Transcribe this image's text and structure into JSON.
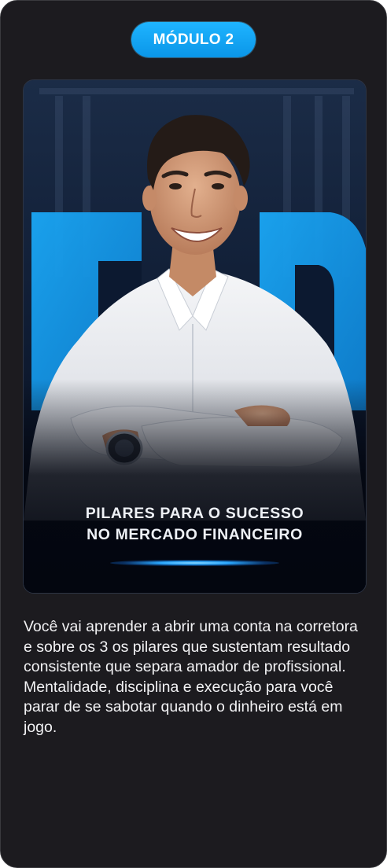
{
  "module_badge": "MÓDULO 2",
  "thumbnail": {
    "title_line1": "PILARES PARA O SUCESSO",
    "title_line2": "NO MERCADO FINANCEIRO",
    "accent_color": "#1fa3f0",
    "background_color": "#0b1426"
  },
  "description": "Você vai aprender a abrir uma conta na corretora e sobre os 3 os pilares que sustentam resultado consistente que separa amador de profissional. Mentalidade, disciplina e execução para você parar de se sabotar quando o dinheiro está em jogo."
}
